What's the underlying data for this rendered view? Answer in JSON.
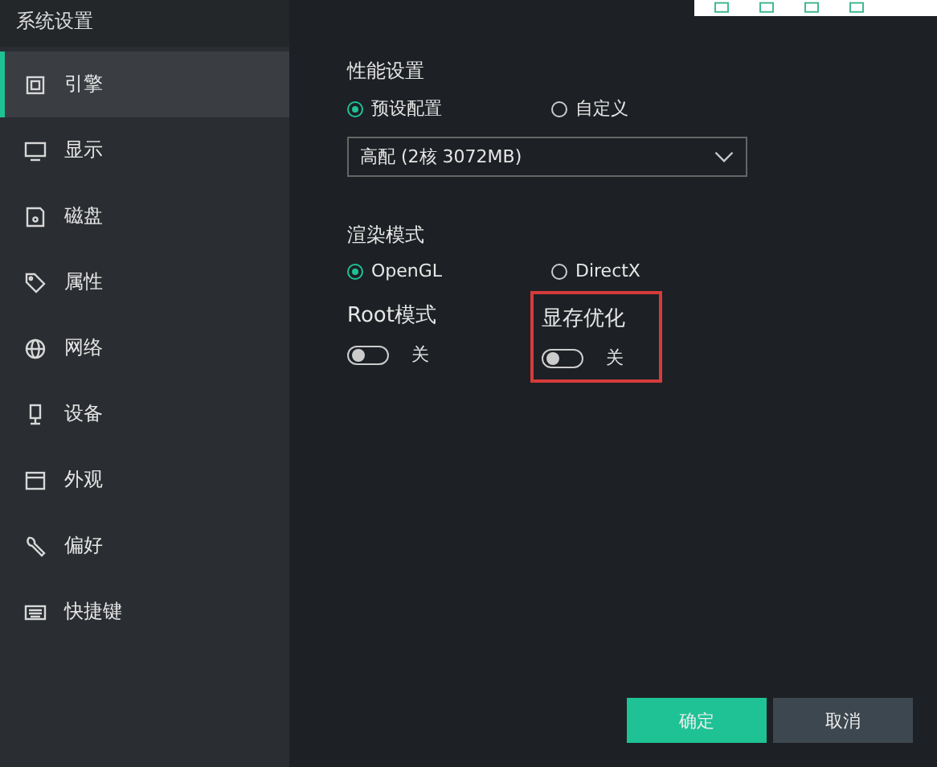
{
  "sidebar": {
    "title": "系统设置",
    "items": [
      {
        "label": "引擎",
        "kind": "chip",
        "selected": true
      },
      {
        "label": "显示",
        "kind": "monitor",
        "selected": false
      },
      {
        "label": "磁盘",
        "kind": "disk",
        "selected": false
      },
      {
        "label": "属性",
        "kind": "tag",
        "selected": false
      },
      {
        "label": "网络",
        "kind": "globe",
        "selected": false
      },
      {
        "label": "设备",
        "kind": "device",
        "selected": false
      },
      {
        "label": "外观",
        "kind": "window",
        "selected": false
      },
      {
        "label": "偏好",
        "kind": "wrench",
        "selected": false
      },
      {
        "label": "快捷键",
        "kind": "keyboard",
        "selected": false
      }
    ]
  },
  "performance": {
    "label": "性能设置",
    "options": [
      {
        "label": "预设配置",
        "selected": true
      },
      {
        "label": "自定义",
        "selected": false
      }
    ],
    "preset": {
      "value": "高配 (2核 3072MB)"
    }
  },
  "render": {
    "label": "渲染模式",
    "options": [
      {
        "label": "OpenGL",
        "selected": true
      },
      {
        "label": "DirectX",
        "selected": false
      }
    ]
  },
  "toggles": [
    {
      "label": "Root模式",
      "on": false,
      "state": "关",
      "highlighted": false
    },
    {
      "label": "显存优化",
      "on": false,
      "state": "关",
      "highlighted": true
    }
  ],
  "buttons": [
    {
      "label": "确定",
      "kind": "primary"
    },
    {
      "label": "取消",
      "kind": "secondary"
    }
  ]
}
